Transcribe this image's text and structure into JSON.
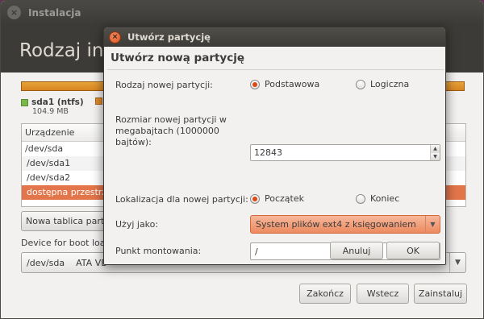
{
  "window": {
    "title": "Instalacja",
    "header": "Rodzaj insta"
  },
  "partition_legend": [
    {
      "name": "sda1 (ntfs)",
      "size": "104.9 MB",
      "color": "#7ab848"
    },
    {
      "name": "",
      "size": "",
      "color": "#e08a2a"
    }
  ],
  "partition_table": {
    "column_header": "Urządzenie",
    "rows": [
      "/dev/sda",
      " /dev/sda1",
      " /dev/sda2",
      " dostępna przestrz"
    ],
    "selected_index": 3
  },
  "new_table_button": "Nowa tablica party",
  "boot_loader": {
    "label": "Device for boot load",
    "device": "/dev/sda",
    "device_name": "ATA VB"
  },
  "footer_buttons": {
    "quit": "Zakończ",
    "back": "Wstecz",
    "install": "Zainstaluj"
  },
  "dialog": {
    "title": "Utwórz partycję",
    "heading": "Utwórz nową partycję",
    "type_label": "Rodzaj nowej partycji:",
    "type_primary": "Podstawowa",
    "type_logical": "Logiczna",
    "type_selected": "Podstawowa",
    "size_label_lines": [
      "Rozmiar nowej partycji w",
      "megabajtach (1000000",
      "bajtów):"
    ],
    "size_value": "12843",
    "location_label": "Lokalizacja dla nowej partycji:",
    "location_begin": "Początek",
    "location_end": "Koniec",
    "location_selected": "Początek",
    "use_as_label": "Użyj jako:",
    "use_as_value": "System plików ext4 z księgowaniem",
    "mount_label": "Punkt montowania:",
    "mount_value": "/",
    "cancel_button": "Anuluj",
    "ok_button": "OK"
  },
  "colors": {
    "accent": "#dd4814",
    "selection": "#e3754a",
    "titlebar": "#3c3b37"
  }
}
